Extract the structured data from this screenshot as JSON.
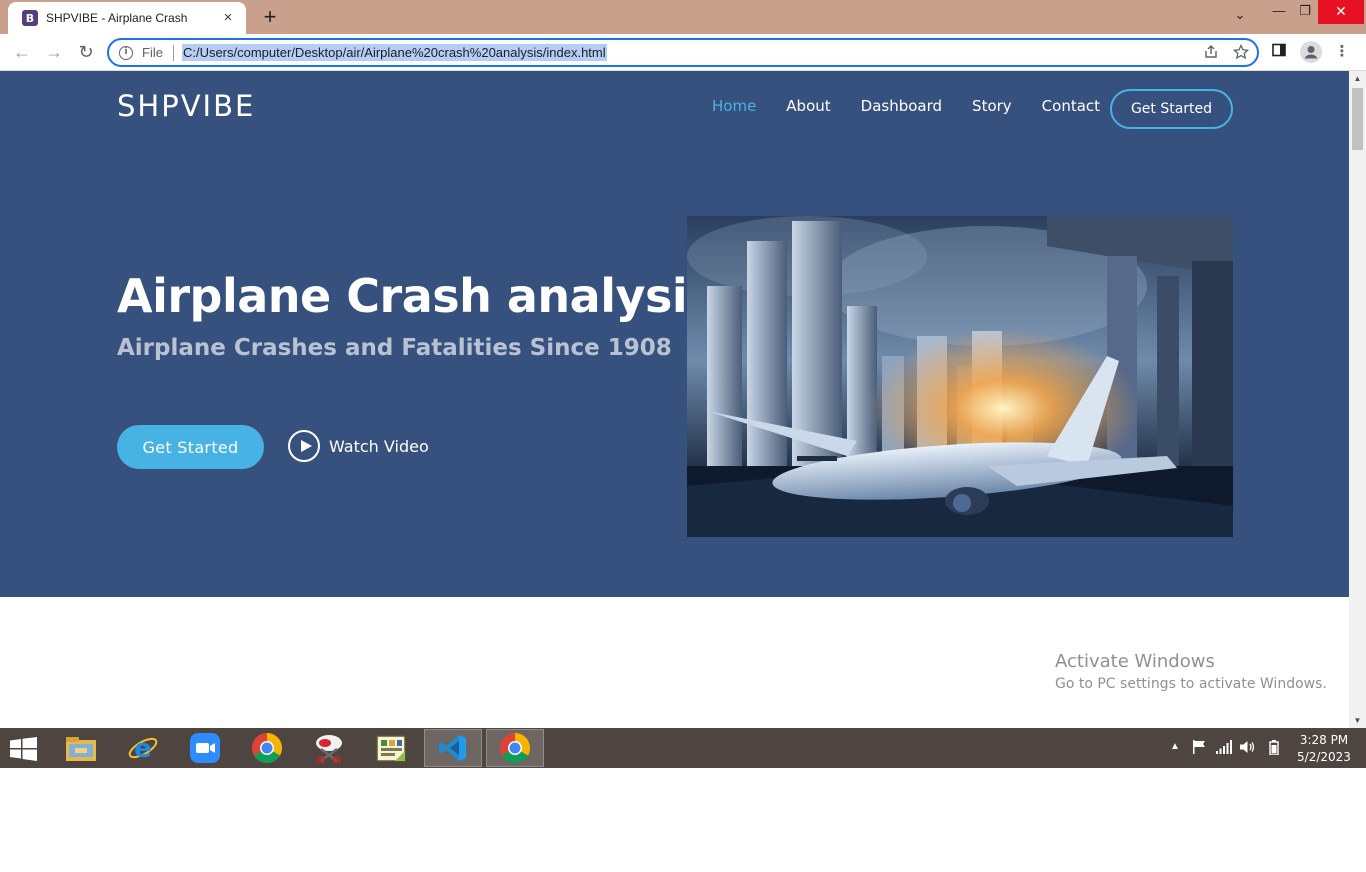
{
  "browser": {
    "tab": {
      "favicon_letter": "B",
      "title": "SHPVIBE - Airplane Crash",
      "close_icon": "×"
    },
    "new_tab_icon": "+",
    "tab_list_icon": "⌄",
    "window_controls": {
      "minimize": "—",
      "maximize": "❐",
      "close": "✕"
    },
    "toolbar": {
      "back_icon": "←",
      "forward_icon": "→",
      "reload_icon": "↻",
      "menu_icon": "⋮"
    },
    "omnibox": {
      "info_icon": "i",
      "scheme_label": "File",
      "url": "C:/Users/computer/Desktop/air/Airplane%20crash%20analysis/index.html"
    }
  },
  "page": {
    "brand": "SHPVIBE",
    "nav": {
      "items": [
        "Home",
        "About",
        "Dashboard",
        "Story",
        "Contact"
      ],
      "active": "Home",
      "cta": "Get Started"
    },
    "hero": {
      "title": "Airplane Crash analysis",
      "subtitle": "Airplane Crashes and Fatalities Since 1908",
      "primary_button": "Get Started",
      "watch_label": "Watch Video"
    },
    "colors": {
      "hero_bg": "#37517e",
      "accent": "#47b2e4"
    }
  },
  "windows_watermark": {
    "title": "Activate Windows",
    "subtitle": "Go to PC settings to activate Windows."
  },
  "taskbar": {
    "apps": [
      "file-explorer",
      "internet-explorer",
      "zoom",
      "chrome",
      "snipping-tool",
      "sticky-app",
      "vscode",
      "chrome"
    ],
    "active_app": "chrome",
    "clock": {
      "time": "3:28 PM",
      "date": "5/2/2023"
    }
  }
}
